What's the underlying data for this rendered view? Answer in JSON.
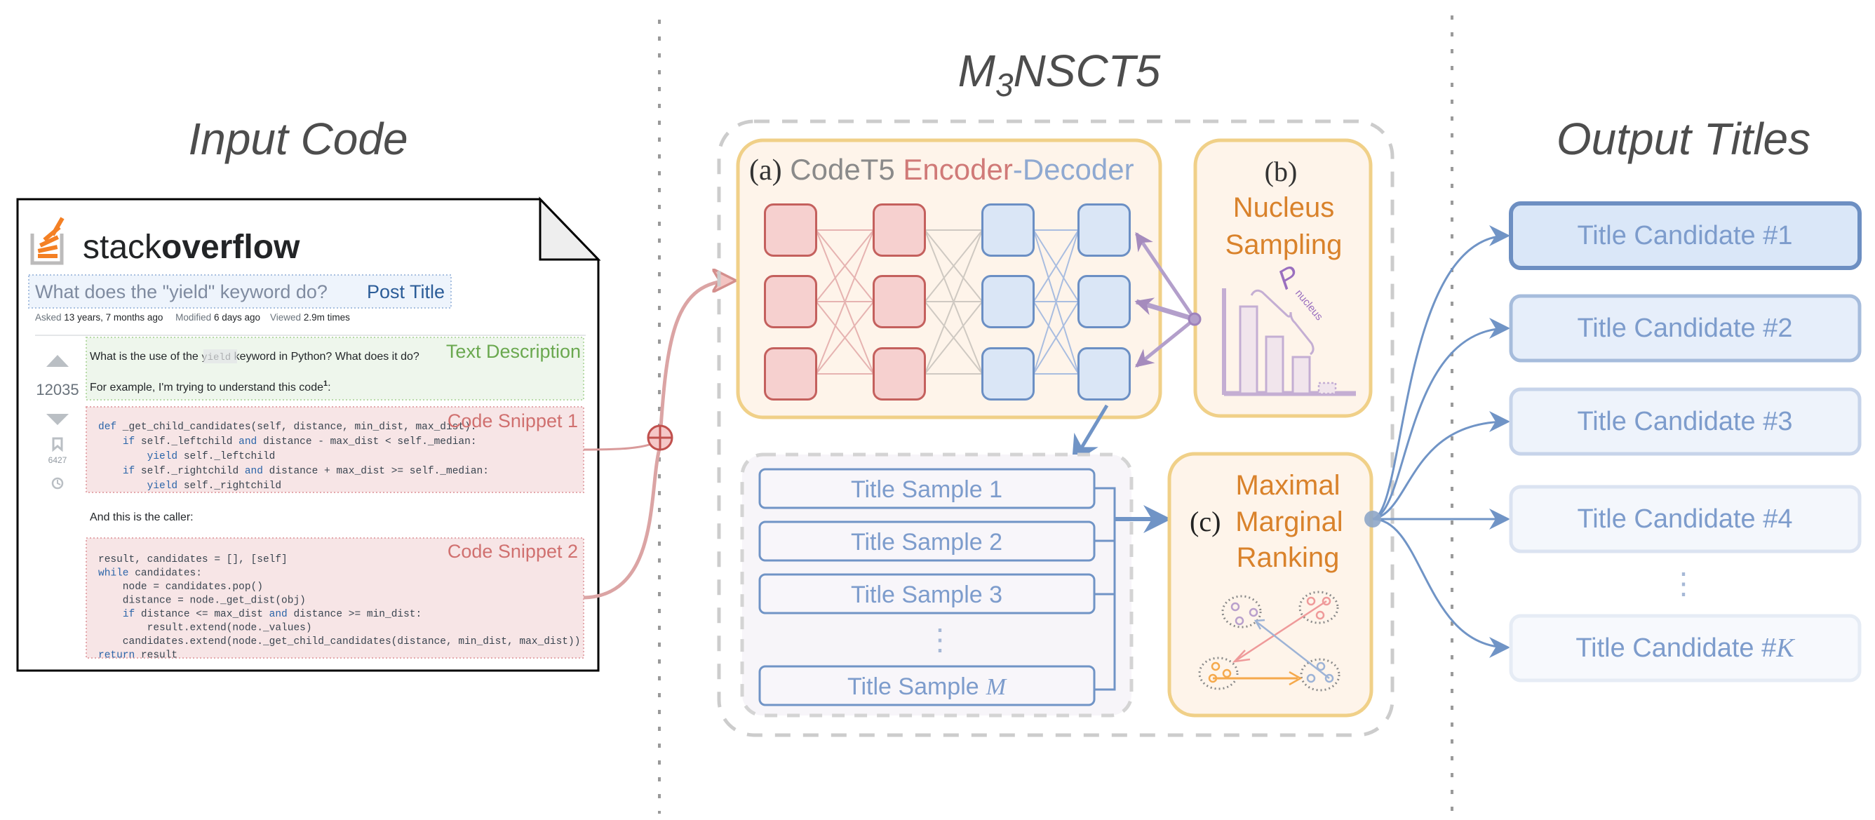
{
  "sections": {
    "input_title": "Input Code",
    "model_title_main": "M",
    "model_title_sub": "3",
    "model_title_rest": "NSCT5",
    "output_title": "Output Titles"
  },
  "stackoverflow": {
    "logo_light": "stack",
    "logo_bold": "overflow",
    "post_title": "What does the \"yield\" keyword do?",
    "post_title_tag": "Post Title",
    "meta": {
      "asked_label": "Asked",
      "asked_value": "13 years, 7 months ago",
      "modified_label": "Modified",
      "modified_value": "6 days ago",
      "viewed_label": "Viewed",
      "viewed_value": "2.9m times"
    },
    "votes": "12035",
    "bookmarks": "6427",
    "text_description_tag": "Text Description",
    "question_line1_pre": "What is the use of the",
    "question_line1_code": "yield",
    "question_line1_post": "keyword in Python? What does it do?",
    "question_line2": "For example, I'm trying to understand this code",
    "question_line2_sup": "1",
    "question_line2_end": ":",
    "code_snippet_1_tag": "Code Snippet 1",
    "code_snippet_1": [
      "def _get_child_candidates(self, distance, min_dist, max_dist):",
      "    if self._leftchild and distance - max_dist < self._median:",
      "        yield self._leftchild",
      "    if self._rightchild and distance + max_dist >= self._median:",
      "        yield self._rightchild"
    ],
    "caller_text": "And this is the caller:",
    "code_snippet_2_tag": "Code Snippet 2",
    "code_snippet_2": [
      "result, candidates = [], [self]",
      "while candidates:",
      "    node = candidates.pop()",
      "    distance = node._get_dist(obj)",
      "    if distance <= max_dist and distance >= min_dist:",
      "        result.extend(node._values)",
      "    candidates.extend(node._get_child_candidates(distance, min_dist, max_dist))",
      "return result"
    ]
  },
  "encoder_decoder": {
    "prefix": "(a)",
    "name": "CodeT5",
    "encoder": "Encoder",
    "dash": "-",
    "decoder": "Decoder"
  },
  "nucleus": {
    "prefix": "(b)",
    "line1": "Nucleus",
    "line2": "Sampling",
    "p_symbol": "P",
    "p_sub": "nucleus"
  },
  "samples": {
    "items": [
      "Title Sample 1",
      "Title Sample 2",
      "Title Sample 3"
    ],
    "last_prefix": "Title Sample",
    "last_var": "M",
    "ellipsis": "⋮"
  },
  "mmr": {
    "prefix": "(c)",
    "line1": "Maximal",
    "line2": "Marginal",
    "line3": "Ranking"
  },
  "candidates": {
    "items": [
      "Title Candidate #1",
      "Title Candidate #2",
      "Title Candidate #3",
      "Title Candidate #4"
    ],
    "last_prefix": "Title Candidate #",
    "last_var": "K",
    "ellipsis": "⋮"
  },
  "colors": {
    "encoder": "#d07a78",
    "decoder": "#8fa9d1",
    "orange": "#d9822b",
    "purple": "#a58bbd",
    "gray_text": "#8a8a8a",
    "so_orange": "#f48024"
  }
}
